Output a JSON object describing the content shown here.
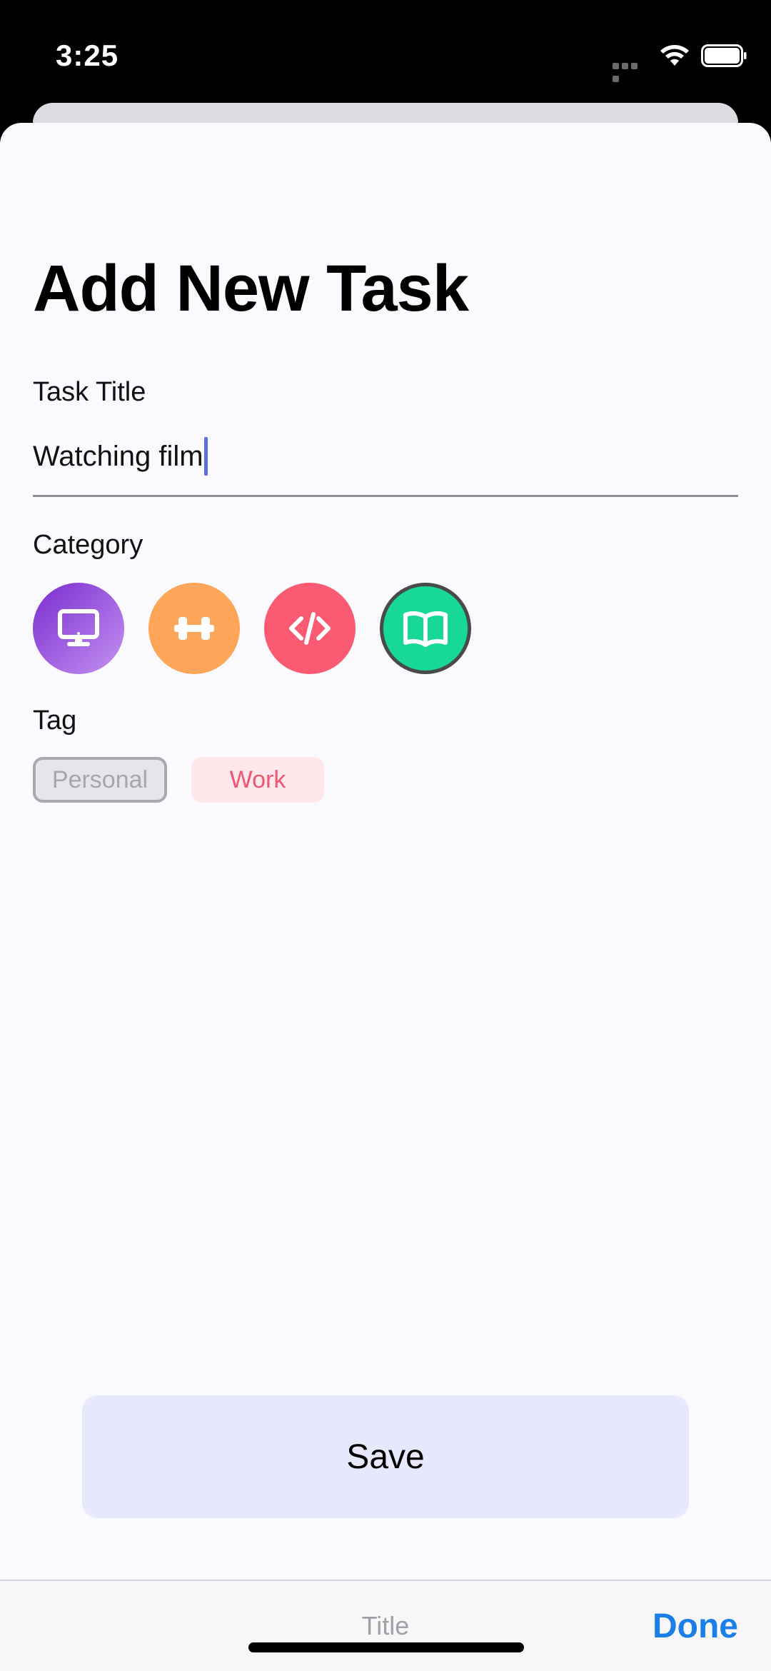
{
  "status_bar": {
    "time": "3:25"
  },
  "sheet": {
    "title": "Add New Task",
    "task_title_label": "Task Title",
    "task_title_value": "Watching film",
    "category_label": "Category",
    "categories": [
      {
        "icon": "monitor-icon",
        "color": "#8b3fd9",
        "selected": false
      },
      {
        "icon": "dumbbell-icon",
        "color": "#fda65a",
        "selected": false
      },
      {
        "icon": "code-icon",
        "color": "#fb5a73",
        "selected": false
      },
      {
        "icon": "book-icon",
        "color": "#17d995",
        "selected": true
      }
    ],
    "tag_label": "Tag",
    "tags": [
      {
        "label": "Personal",
        "selected": true
      },
      {
        "label": "Work",
        "selected": false
      }
    ],
    "save_label": "Save"
  },
  "accessory_bar": {
    "title": "Title",
    "done_label": "Done"
  },
  "colors": {
    "accent": "#1a7fe8",
    "save_bg": "#e8e8fd",
    "sheet_bg": "#fafafe"
  }
}
